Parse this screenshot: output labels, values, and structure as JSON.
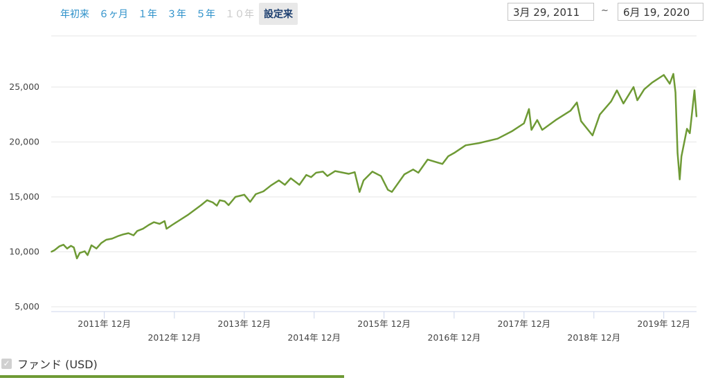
{
  "range_selector": {
    "buttons": [
      {
        "label": "年初来",
        "state": "normal"
      },
      {
        "label": "６ヶ月",
        "state": "normal"
      },
      {
        "label": "１年",
        "state": "normal"
      },
      {
        "label": "３年",
        "state": "normal"
      },
      {
        "label": "５年",
        "state": "normal"
      },
      {
        "label": "１０年",
        "state": "disabled"
      },
      {
        "label": "設定来",
        "state": "active"
      }
    ],
    "from_date": "3月 29, 2011",
    "separator": "~",
    "to_date": "6月 19, 2020"
  },
  "legend": {
    "label": "ファンド (USD)",
    "checked": true,
    "color": "#6e9a35"
  },
  "chart_data": {
    "type": "line",
    "title": "",
    "xlabel": "",
    "ylabel": "",
    "x_range": [
      "2011-03-29",
      "2020-06-19"
    ],
    "ylim": [
      5000,
      27000
    ],
    "y_ticks": [
      5000,
      10000,
      15000,
      20000,
      25000
    ],
    "y_tick_labels": [
      "5,000",
      "10,000",
      "15,000",
      "20,000",
      "25,000"
    ],
    "x_ticks": [
      {
        "date": "2011-12",
        "label": "2011年 12月"
      },
      {
        "date": "2012-12",
        "label": "2012年 12月"
      },
      {
        "date": "2013-12",
        "label": "2013年 12月"
      },
      {
        "date": "2014-12",
        "label": "2014年 12月"
      },
      {
        "date": "2015-12",
        "label": "2015年 12月"
      },
      {
        "date": "2016-12",
        "label": "2016年 12月"
      },
      {
        "date": "2017-12",
        "label": "2017年 12月"
      },
      {
        "date": "2018-12",
        "label": "2018年 12月"
      },
      {
        "date": "2019-12",
        "label": "2019年 12月"
      }
    ],
    "grid": "horizontal",
    "series": [
      {
        "color": "#6e9a35",
        "points": [
          [
            "2011-03-29",
            10000
          ],
          [
            "2011-04-15",
            10150
          ],
          [
            "2011-05-10",
            10500
          ],
          [
            "2011-06-01",
            10650
          ],
          [
            "2011-06-20",
            10300
          ],
          [
            "2011-07-10",
            10550
          ],
          [
            "2011-07-25",
            10400
          ],
          [
            "2011-08-10",
            9400
          ],
          [
            "2011-08-25",
            9900
          ],
          [
            "2011-09-20",
            10050
          ],
          [
            "2011-10-05",
            9700
          ],
          [
            "2011-10-25",
            10600
          ],
          [
            "2011-11-20",
            10300
          ],
          [
            "2011-12-15",
            10800
          ],
          [
            "2012-01-10",
            11100
          ],
          [
            "2012-02-10",
            11200
          ],
          [
            "2012-03-15",
            11450
          ],
          [
            "2012-04-10",
            11600
          ],
          [
            "2012-05-05",
            11700
          ],
          [
            "2012-06-01",
            11500
          ],
          [
            "2012-06-20",
            11900
          ],
          [
            "2012-07-20",
            12100
          ],
          [
            "2012-08-20",
            12450
          ],
          [
            "2012-09-15",
            12700
          ],
          [
            "2012-10-15",
            12550
          ],
          [
            "2012-11-10",
            12800
          ],
          [
            "2012-11-20",
            12100
          ],
          [
            "2012-12-20",
            12450
          ],
          [
            "2013-01-20",
            12800
          ],
          [
            "2013-03-15",
            13400
          ],
          [
            "2013-05-20",
            14250
          ],
          [
            "2013-06-20",
            14700
          ],
          [
            "2013-07-20",
            14500
          ],
          [
            "2013-08-10",
            14200
          ],
          [
            "2013-08-25",
            14700
          ],
          [
            "2013-09-20",
            14600
          ],
          [
            "2013-10-10",
            14250
          ],
          [
            "2013-11-15",
            15000
          ],
          [
            "2013-12-31",
            15200
          ],
          [
            "2014-01-31",
            14550
          ],
          [
            "2014-03-01",
            15250
          ],
          [
            "2014-04-10",
            15500
          ],
          [
            "2014-05-20",
            16050
          ],
          [
            "2014-06-30",
            16500
          ],
          [
            "2014-07-31",
            16100
          ],
          [
            "2014-08-31",
            16700
          ],
          [
            "2014-10-15",
            16100
          ],
          [
            "2014-11-20",
            17000
          ],
          [
            "2014-12-15",
            16800
          ],
          [
            "2015-01-10",
            17200
          ],
          [
            "2015-02-15",
            17300
          ],
          [
            "2015-03-10",
            16900
          ],
          [
            "2015-04-20",
            17350
          ],
          [
            "2015-06-30",
            17100
          ],
          [
            "2015-07-31",
            17250
          ],
          [
            "2015-08-25",
            15450
          ],
          [
            "2015-09-15",
            16500
          ],
          [
            "2015-10-31",
            17300
          ],
          [
            "2015-12-15",
            16900
          ],
          [
            "2016-01-20",
            15650
          ],
          [
            "2016-02-10",
            15450
          ],
          [
            "2016-04-15",
            17050
          ],
          [
            "2016-05-31",
            17500
          ],
          [
            "2016-06-27",
            17200
          ],
          [
            "2016-08-15",
            18400
          ],
          [
            "2016-10-31",
            18000
          ],
          [
            "2016-11-30",
            18700
          ],
          [
            "2016-12-31",
            19000
          ],
          [
            "2017-03-01",
            19700
          ],
          [
            "2017-05-10",
            19900
          ],
          [
            "2017-08-15",
            20300
          ],
          [
            "2017-10-31",
            21000
          ],
          [
            "2017-12-31",
            21700
          ],
          [
            "2018-01-26",
            23000
          ],
          [
            "2018-02-08",
            21100
          ],
          [
            "2018-03-10",
            22000
          ],
          [
            "2018-04-05",
            21100
          ],
          [
            "2018-06-15",
            22000
          ],
          [
            "2018-08-31",
            22850
          ],
          [
            "2018-10-03",
            23600
          ],
          [
            "2018-10-25",
            21900
          ],
          [
            "2018-12-24",
            20600
          ],
          [
            "2019-01-31",
            22500
          ],
          [
            "2019-03-31",
            23700
          ],
          [
            "2019-04-30",
            24700
          ],
          [
            "2019-06-03",
            23500
          ],
          [
            "2019-07-26",
            25000
          ],
          [
            "2019-08-15",
            23800
          ],
          [
            "2019-09-20",
            24800
          ],
          [
            "2019-10-31",
            25400
          ],
          [
            "2019-12-31",
            26100
          ],
          [
            "2020-01-31",
            25300
          ],
          [
            "2020-02-19",
            26200
          ],
          [
            "2020-03-01",
            24500
          ],
          [
            "2020-03-12",
            19000
          ],
          [
            "2020-03-23",
            16600
          ],
          [
            "2020-04-01",
            18700
          ],
          [
            "2020-04-30",
            21200
          ],
          [
            "2020-05-15",
            20800
          ],
          [
            "2020-06-08",
            24700
          ],
          [
            "2020-06-19",
            22300
          ]
        ]
      }
    ]
  }
}
